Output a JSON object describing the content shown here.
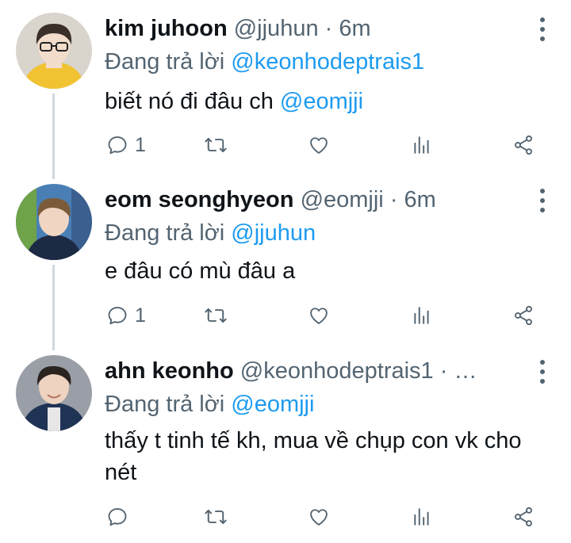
{
  "tweets": [
    {
      "name": "kim juhoon",
      "handle": "@jjuhun",
      "separator": "·",
      "time": "6m",
      "reply_prefix": "Đang trả lời",
      "reply_to": "@keonhodeptrais1",
      "text_before": "biết nó đi đâu ch",
      "text_mention": "@eomjji",
      "reply_count": "1",
      "avatar_colors": {
        "bg": "#d9d4cc",
        "jacket": "#f1c232",
        "skin": "#f2dccb",
        "hair": "#3b3029"
      }
    },
    {
      "name": "eom seonghyeon",
      "handle": "@eomjji",
      "separator": "·",
      "time": "6m",
      "reply_prefix": "Đang trả lời",
      "reply_to": "@jjuhun",
      "text": "e đâu có mù đâu a",
      "reply_count": "1",
      "avatar_colors": {
        "bg": "#4a7fb5",
        "shirt": "#1d2a44",
        "skin": "#f0d6c2",
        "hair": "#7b5b3a"
      }
    },
    {
      "name": "ahn keonho",
      "handle": "@keonhodeptrais1",
      "separator": "· …",
      "reply_prefix": "Đang trả lời",
      "reply_to": "@eomjji",
      "text": "thấy t tinh tế kh, mua về chụp con vk cho nét",
      "avatar_colors": {
        "bg": "#9a9ea6",
        "shirt": "#1f3354",
        "skin": "#eed3c0",
        "hair": "#2a2320"
      }
    }
  ],
  "colors": {
    "text": "#0f1419",
    "secondary": "#536471",
    "link": "#1d9bf0",
    "thread": "#cfd9de"
  },
  "icons": [
    "reply-icon",
    "retweet-icon",
    "like-icon",
    "views-icon",
    "share-icon",
    "more-icon"
  ]
}
